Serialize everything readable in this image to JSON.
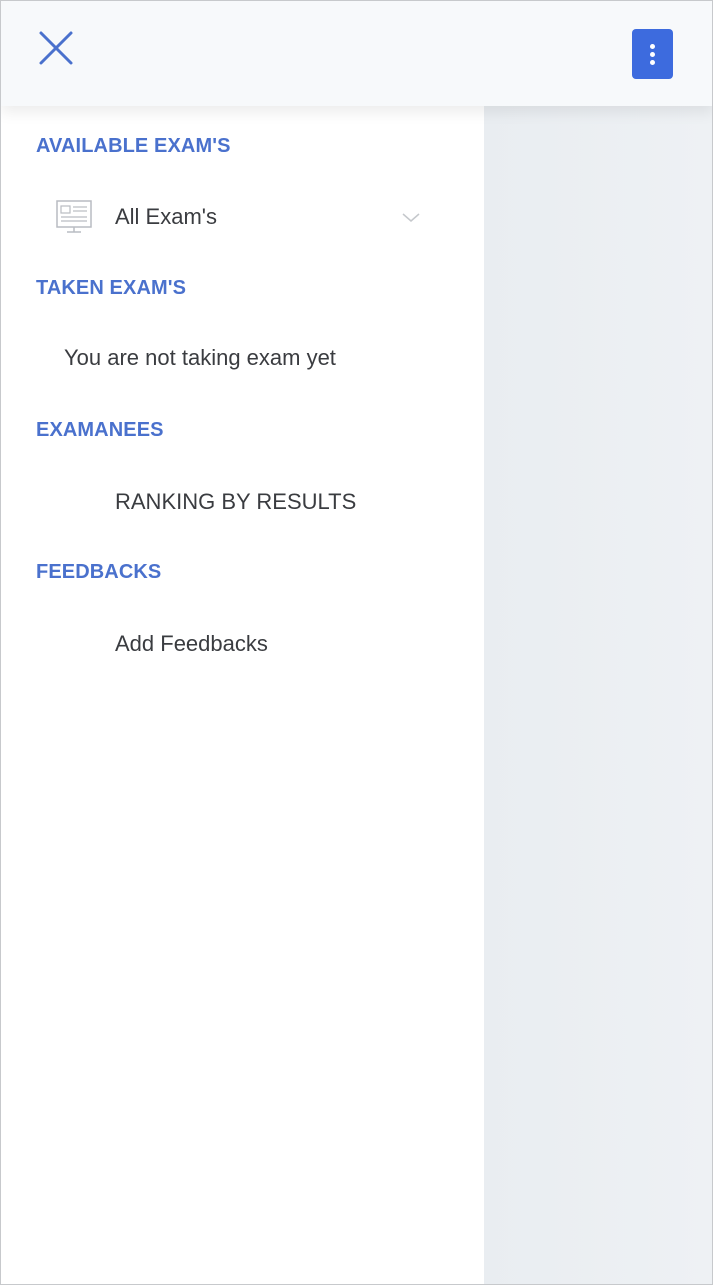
{
  "topbar": {
    "close_icon": "close-icon",
    "more_icon": "more-vertical-icon",
    "accent_color": "#3d6bde"
  },
  "drawer": {
    "sections": [
      {
        "title": "AVAILABLE EXAM'S",
        "items": [
          {
            "label": "All Exam's",
            "icon": "exam-board-icon",
            "trailing_icon": "chevron-down-icon"
          }
        ]
      },
      {
        "title": "TAKEN EXAM'S",
        "items": [
          {
            "label": "You are not taking exam yet"
          }
        ]
      },
      {
        "title": "EXAMANEES",
        "items": [
          {
            "label": "RANKING BY RESULTS"
          }
        ]
      },
      {
        "title": "FEEDBACKS",
        "items": [
          {
            "label": "Add Feedbacks"
          }
        ]
      }
    ],
    "header_color": "#4a71cd"
  }
}
